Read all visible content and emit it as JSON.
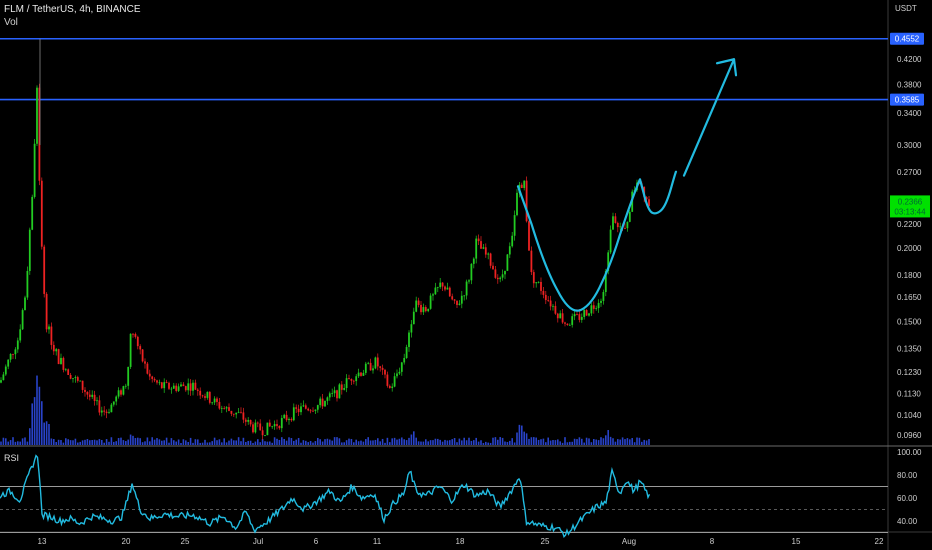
{
  "header": {
    "symbol_line": "FLM / TetherUS, 4h, BINANCE",
    "volume_label": "Vol"
  },
  "chart_data": {
    "type": "candlestick",
    "price_axis": {
      "unit": "USDT",
      "scale": "log",
      "ticks": [
        "0.4200",
        "0.3800",
        "0.3400",
        "0.3000",
        "0.2700",
        "0.2400",
        "0.2200",
        "0.2000",
        "0.1800",
        "0.1650",
        "0.1500",
        "0.1350",
        "0.1230",
        "0.1130",
        "0.1040",
        "0.0960"
      ],
      "range": [
        0.092,
        0.53
      ]
    },
    "time_axis": {
      "ticks": [
        "13",
        "20",
        "25",
        "Jul",
        "6",
        "11",
        "18",
        "25",
        "Aug",
        "8",
        "15",
        "22"
      ]
    },
    "horizontal_lines": [
      {
        "price": 0.4552,
        "label": "0.4552",
        "color": "#2962ff"
      },
      {
        "price": 0.3585,
        "label": "0.3585",
        "color": "#2962ff"
      }
    ],
    "last_price": {
      "value": "0.2366",
      "countdown": "03:13:44",
      "color": "#00e000"
    },
    "colors": {
      "up": "#22cc22",
      "down": "#ee2222",
      "volume": "#2943c9",
      "drawing": "#22bbe0",
      "rsi_line": "#22bbe0"
    },
    "price_path": [
      [
        0,
        0.118
      ],
      [
        8,
        0.128
      ],
      [
        18,
        0.14
      ],
      [
        26,
        0.17
      ],
      [
        33,
        0.26
      ],
      [
        37,
        0.37
      ],
      [
        41,
        0.21
      ],
      [
        46,
        0.15
      ],
      [
        52,
        0.138
      ],
      [
        58,
        0.13
      ],
      [
        66,
        0.125
      ],
      [
        74,
        0.12
      ],
      [
        84,
        0.115
      ],
      [
        96,
        0.108
      ],
      [
        106,
        0.105
      ],
      [
        118,
        0.112
      ],
      [
        126,
        0.118
      ],
      [
        132,
        0.148
      ],
      [
        140,
        0.132
      ],
      [
        150,
        0.12
      ],
      [
        162,
        0.116
      ],
      [
        176,
        0.116
      ],
      [
        192,
        0.117
      ],
      [
        206,
        0.112
      ],
      [
        222,
        0.107
      ],
      [
        240,
        0.104
      ],
      [
        252,
        0.099
      ],
      [
        264,
        0.098
      ],
      [
        280,
        0.101
      ],
      [
        298,
        0.106
      ],
      [
        318,
        0.108
      ],
      [
        336,
        0.113
      ],
      [
        352,
        0.121
      ],
      [
        364,
        0.124
      ],
      [
        376,
        0.128
      ],
      [
        390,
        0.115
      ],
      [
        404,
        0.13
      ],
      [
        414,
        0.16
      ],
      [
        426,
        0.158
      ],
      [
        442,
        0.175
      ],
      [
        456,
        0.158
      ],
      [
        468,
        0.175
      ],
      [
        476,
        0.205
      ],
      [
        490,
        0.19
      ],
      [
        500,
        0.175
      ],
      [
        512,
        0.205
      ],
      [
        518,
        0.255
      ],
      [
        524,
        0.26
      ],
      [
        531,
        0.18
      ],
      [
        540,
        0.172
      ],
      [
        552,
        0.16
      ],
      [
        566,
        0.149
      ],
      [
        580,
        0.153
      ],
      [
        594,
        0.16
      ],
      [
        604,
        0.168
      ],
      [
        612,
        0.232
      ],
      [
        624,
        0.21
      ],
      [
        632,
        0.245
      ],
      [
        638,
        0.265
      ],
      [
        650,
        0.236
      ]
    ],
    "volume_spikes": [
      [
        37,
        100
      ],
      [
        41,
        68
      ],
      [
        33,
        55
      ],
      [
        47,
        40
      ],
      [
        132,
        18
      ],
      [
        413,
        22
      ],
      [
        520,
        30
      ],
      [
        525,
        24
      ],
      [
        608,
        16
      ]
    ],
    "projection": {
      "cup": [
        [
          518,
          0.255
        ],
        [
          545,
          0.185
        ],
        [
          570,
          0.154
        ],
        [
          592,
          0.16
        ],
        [
          612,
          0.19
        ],
        [
          628,
          0.232
        ],
        [
          640,
          0.262
        ]
      ],
      "handle": [
        [
          640,
          0.262
        ],
        [
          648,
          0.232
        ],
        [
          656,
          0.228
        ],
        [
          666,
          0.236
        ],
        [
          676,
          0.27
        ]
      ],
      "arrow_from": [
        684,
        0.266
      ],
      "arrow_to": [
        734,
        0.42
      ]
    },
    "rsi": {
      "label": "RSI",
      "ticks": [
        "100.00",
        "80.00",
        "60.00",
        "40.00"
      ],
      "levels": [
        70,
        50,
        30
      ],
      "path": [
        [
          0,
          62
        ],
        [
          10,
          66
        ],
        [
          20,
          58
        ],
        [
          28,
          78
        ],
        [
          34,
          92
        ],
        [
          38,
          98
        ],
        [
          42,
          45
        ],
        [
          50,
          44
        ],
        [
          60,
          40
        ],
        [
          70,
          42
        ],
        [
          80,
          38
        ],
        [
          92,
          44
        ],
        [
          104,
          42
        ],
        [
          114,
          40
        ],
        [
          122,
          44
        ],
        [
          128,
          60
        ],
        [
          132,
          73
        ],
        [
          140,
          50
        ],
        [
          150,
          42
        ],
        [
          164,
          46
        ],
        [
          178,
          44
        ],
        [
          194,
          45
        ],
        [
          210,
          38
        ],
        [
          224,
          44
        ],
        [
          236,
          34
        ],
        [
          246,
          48
        ],
        [
          254,
          32
        ],
        [
          268,
          40
        ],
        [
          284,
          52
        ],
        [
          292,
          60
        ],
        [
          304,
          50
        ],
        [
          318,
          58
        ],
        [
          330,
          66
        ],
        [
          340,
          56
        ],
        [
          352,
          70
        ],
        [
          362,
          60
        ],
        [
          374,
          64
        ],
        [
          384,
          42
        ],
        [
          394,
          56
        ],
        [
          404,
          64
        ],
        [
          410,
          84
        ],
        [
          416,
          66
        ],
        [
          426,
          62
        ],
        [
          440,
          70
        ],
        [
          452,
          58
        ],
        [
          464,
          72
        ],
        [
          476,
          62
        ],
        [
          488,
          66
        ],
        [
          500,
          52
        ],
        [
          514,
          70
        ],
        [
          520,
          80
        ],
        [
          526,
          40
        ],
        [
          540,
          36
        ],
        [
          556,
          34
        ],
        [
          566,
          28
        ],
        [
          580,
          40
        ],
        [
          596,
          52
        ],
        [
          606,
          56
        ],
        [
          612,
          82
        ],
        [
          620,
          64
        ],
        [
          626,
          76
        ],
        [
          634,
          66
        ],
        [
          640,
          74
        ],
        [
          650,
          60
        ]
      ]
    }
  }
}
